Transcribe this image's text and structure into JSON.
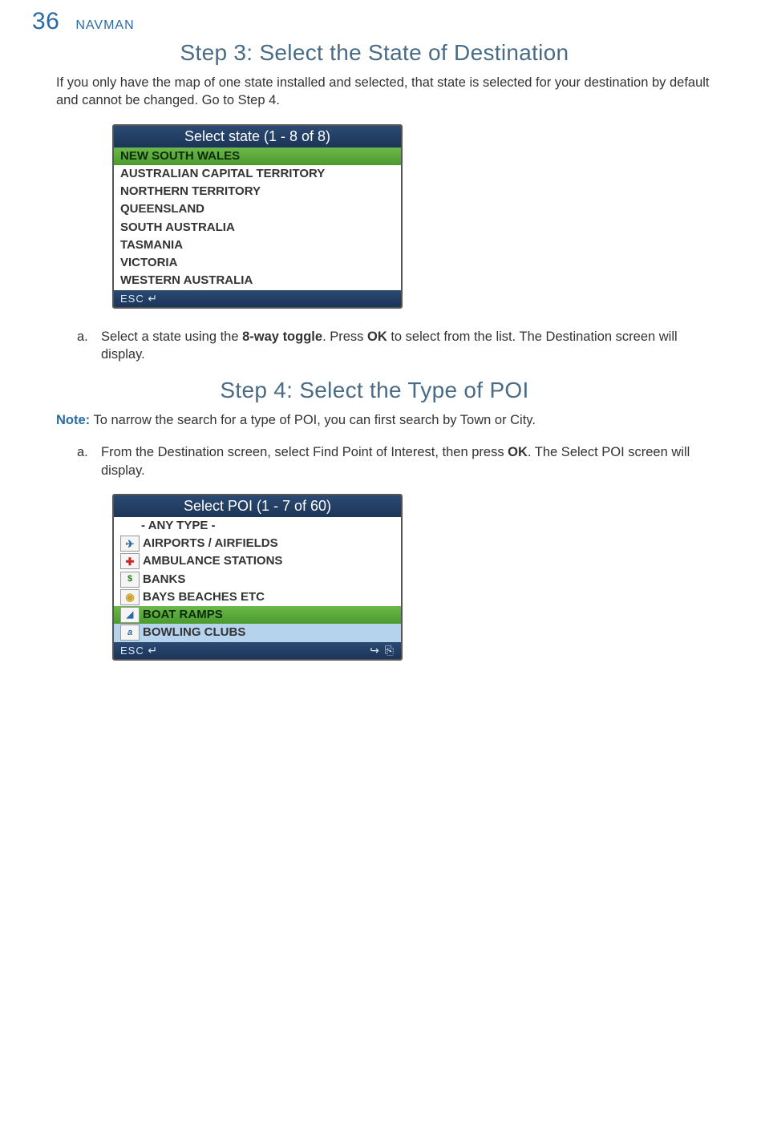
{
  "header": {
    "page_number": "36",
    "brand": "NAVMAN"
  },
  "step3": {
    "title": "Step 3: Select the State of Destination",
    "intro": "If you only have the map of one state installed and selected, that state is selected for your destination by default and cannot be changed. Go to Step 4.",
    "device": {
      "title": "Select state (1 - 8 of 8)",
      "items": [
        "NEW SOUTH WALES",
        "AUSTRALIAN CAPITAL TERRITORY",
        "NORTHERN TERRITORY",
        "QUEENSLAND",
        "SOUTH AUSTRALIA",
        "TASMANIA",
        "VICTORIA",
        "WESTERN AUSTRALIA"
      ],
      "footer_esc": "ESC",
      "footer_enter": "↵"
    },
    "bullet_marker": "a.",
    "bullet_pre": "Select a state using the ",
    "bullet_b1": "8-way toggle",
    "bullet_mid": ". Press ",
    "bullet_b2": "OK",
    "bullet_post": " to select from the list. The Destination screen will display."
  },
  "step4": {
    "title": "Step 4: Select the Type of POI",
    "note_label": "Note:",
    "note_text": " To narrow the search for a type of POI, you can first search by Town or City.",
    "bullet_marker": "a.",
    "bullet_pre": "From the Destination screen, select Find Point of Interest, then press ",
    "bullet_b1": "OK",
    "bullet_post": ". The Select POI screen will display.",
    "device": {
      "title": "Select POI (1 - 7 of 60)",
      "items": [
        "- ANY TYPE -",
        "AIRPORTS / AIRFIELDS",
        "AMBULANCE STATIONS",
        "BANKS",
        "BAYS BEACHES ETC",
        "BOAT RAMPS",
        "BOWLING CLUBS"
      ],
      "footer_esc": "ESC",
      "footer_enter": "↵",
      "footer_loop": "↪",
      "footer_copy": "⎘"
    }
  }
}
